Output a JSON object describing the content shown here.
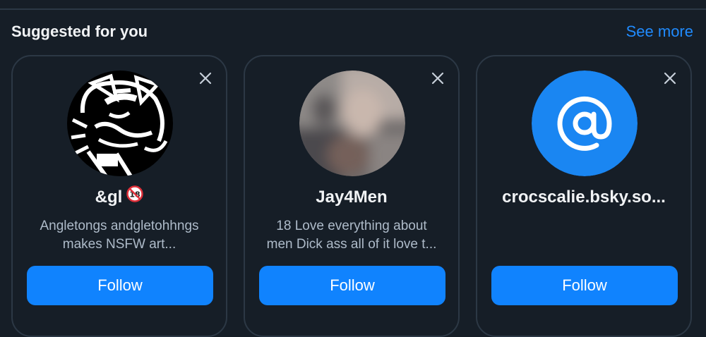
{
  "section": {
    "title": "Suggested for you",
    "see_more": "See more"
  },
  "cards": [
    {
      "name": "&gl",
      "badge_text": "18",
      "bio_line1": "Angletongs andgletohhngs",
      "bio_line2": "makes NSFW art...",
      "follow_label": "Follow"
    },
    {
      "name": "Jay4Men",
      "bio_line1": "18 Love everything about",
      "bio_line2": "men Dick ass all of it love t...",
      "follow_label": "Follow"
    },
    {
      "name": "crocscalie.bsky.so...",
      "bio_line1": "",
      "bio_line2": "",
      "follow_label": "Follow"
    }
  ],
  "colors": {
    "background": "#161e27",
    "card_border": "#2c3845",
    "accent": "#1083fe",
    "link": "#208bfe",
    "muted_text": "#aebbc9"
  },
  "icons": {
    "dismiss": "close-icon",
    "default_avatar": "at-sign-icon",
    "adult_badge": "no-under-18-icon"
  }
}
